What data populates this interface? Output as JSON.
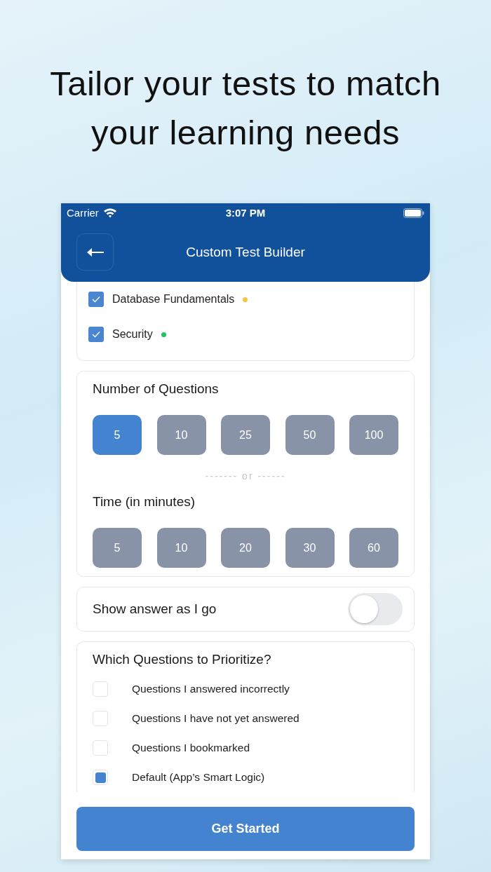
{
  "headline": "Tailor your tests to match your learning needs",
  "status_bar": {
    "carrier": "Carrier",
    "time": "3:07 PM"
  },
  "nav": {
    "title": "Custom Test Builder"
  },
  "topics": [
    {
      "label": "Database Fundamentals",
      "checked": true,
      "color": "#f5c542"
    },
    {
      "label": "Security",
      "checked": true,
      "color": "#1fc164"
    }
  ],
  "questions": {
    "title": "Number of Questions",
    "options": [
      {
        "label": "5",
        "selected": true
      },
      {
        "label": "10",
        "selected": false
      },
      {
        "label": "25",
        "selected": false
      },
      {
        "label": "50",
        "selected": false
      },
      {
        "label": "100",
        "selected": false
      }
    ]
  },
  "divider": "------- or ------",
  "time": {
    "title": "Time (in minutes)",
    "options": [
      {
        "label": "5",
        "selected": false
      },
      {
        "label": "10",
        "selected": false
      },
      {
        "label": "20",
        "selected": false
      },
      {
        "label": "30",
        "selected": false
      },
      {
        "label": "60",
        "selected": false
      }
    ]
  },
  "show_answer": {
    "label": "Show answer as I go",
    "on": false
  },
  "priority": {
    "title": "Which Questions to Prioritize?",
    "items": [
      {
        "label": "Questions I answered incorrectly",
        "checked": false
      },
      {
        "label": "Questions I have not yet answered",
        "checked": false
      },
      {
        "label": "Questions I bookmarked",
        "checked": false
      },
      {
        "label": "Default (App’s Smart Logic)",
        "checked": true
      }
    ]
  },
  "button": "Get Started"
}
